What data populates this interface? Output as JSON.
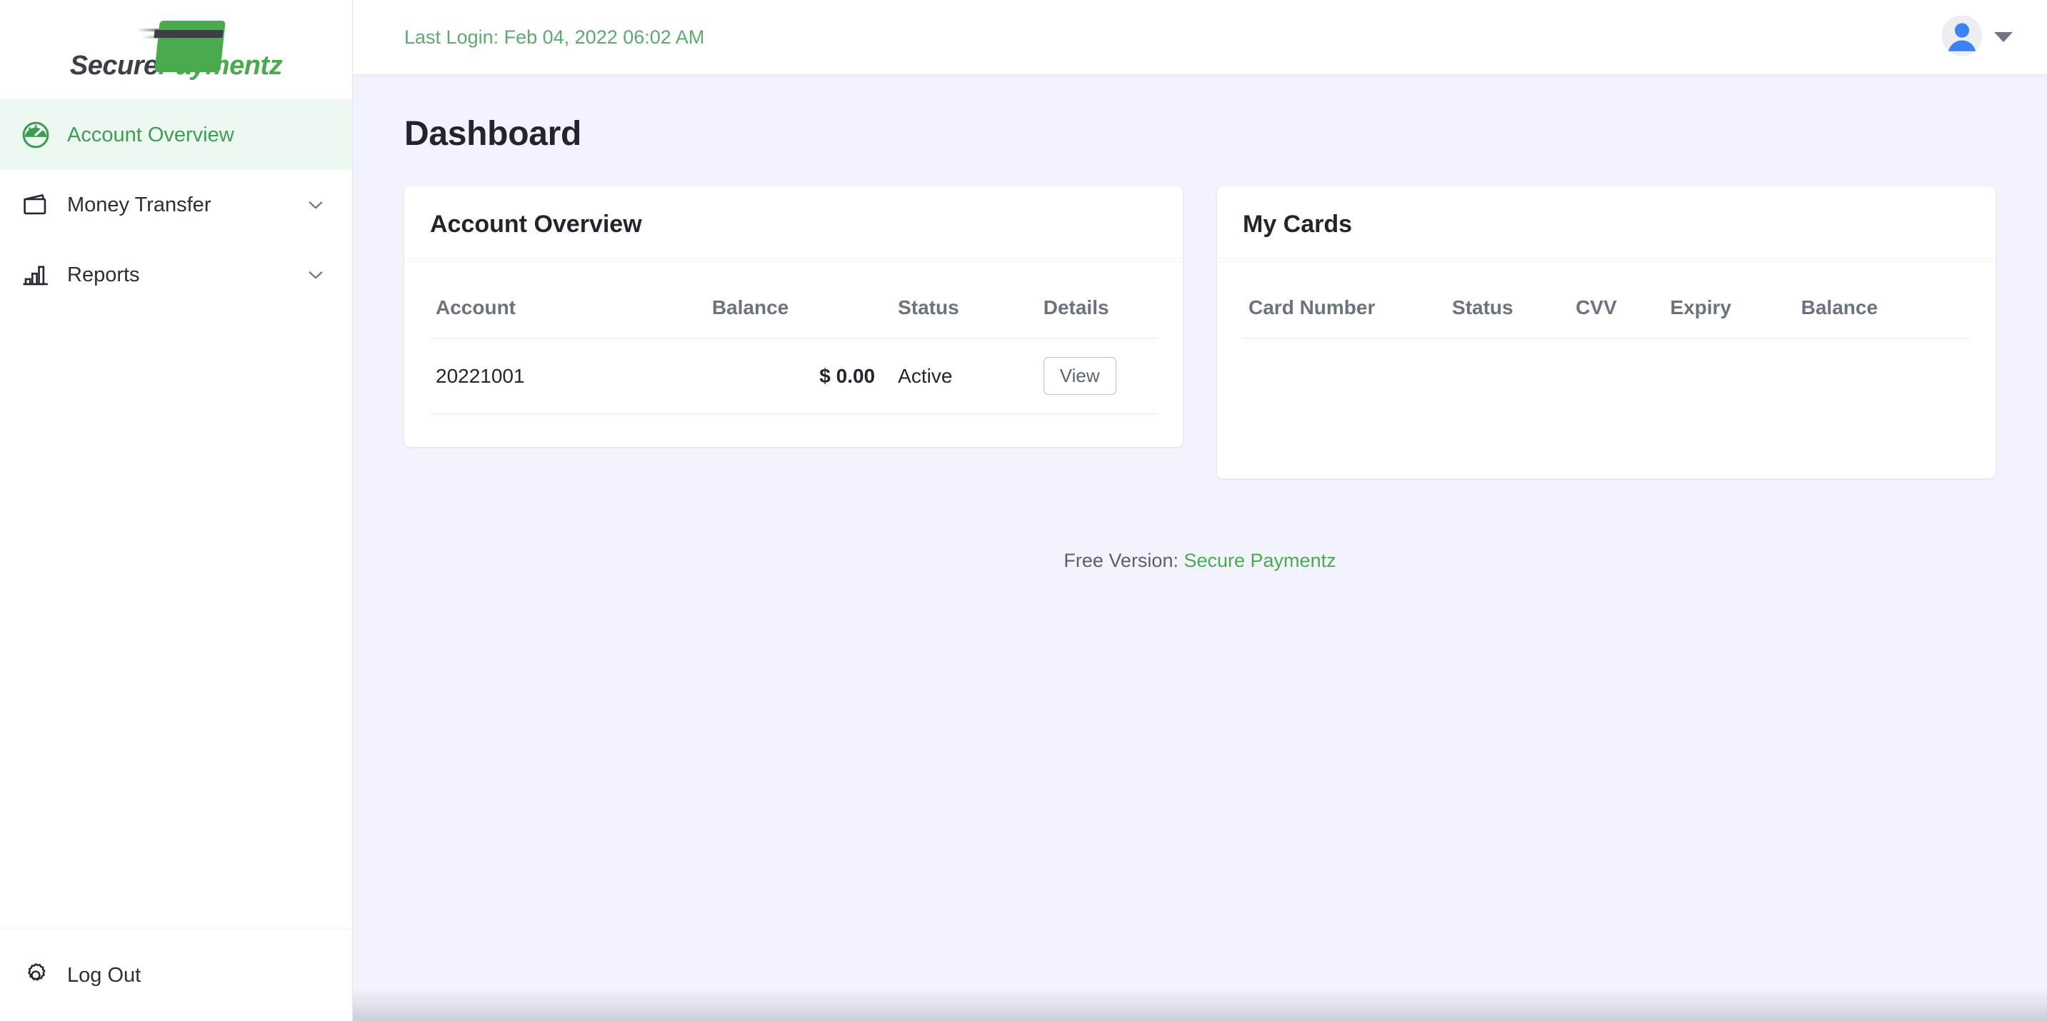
{
  "brand": {
    "name_part1": "Secure",
    "name_part2": "Paymentz",
    "logo_icon": "credit-card-logo",
    "accent_green": "#4aab4e",
    "dark": "#3b3f46"
  },
  "sidebar": {
    "items": [
      {
        "label": "Account Overview",
        "icon": "speedometer-icon",
        "active": true,
        "has_chevron": false
      },
      {
        "label": "Money Transfer",
        "icon": "wallet-icon",
        "active": false,
        "has_chevron": true
      },
      {
        "label": "Reports",
        "icon": "bar-chart-icon",
        "active": false,
        "has_chevron": true
      }
    ],
    "logout": {
      "label": "Log Out",
      "icon": "gear-icon"
    }
  },
  "topbar": {
    "last_login": "Last Login: Feb 04, 2022 06:02 AM",
    "avatar_icon": "user-avatar-icon",
    "caret_icon": "caret-down-icon"
  },
  "page": {
    "title": "Dashboard"
  },
  "account_overview_card": {
    "title": "Account Overview",
    "columns": [
      "Account",
      "Balance",
      "Status",
      "Details"
    ],
    "rows": [
      {
        "account": "20221001",
        "balance": "$ 0.00",
        "status": "Active",
        "details_button": "View"
      }
    ]
  },
  "my_cards_card": {
    "title": "My Cards",
    "columns": [
      "Card Number",
      "Status",
      "CVV",
      "Expiry",
      "Balance"
    ],
    "rows": []
  },
  "footer": {
    "prefix": "Free Version:",
    "link_label": "Secure Paymentz"
  }
}
